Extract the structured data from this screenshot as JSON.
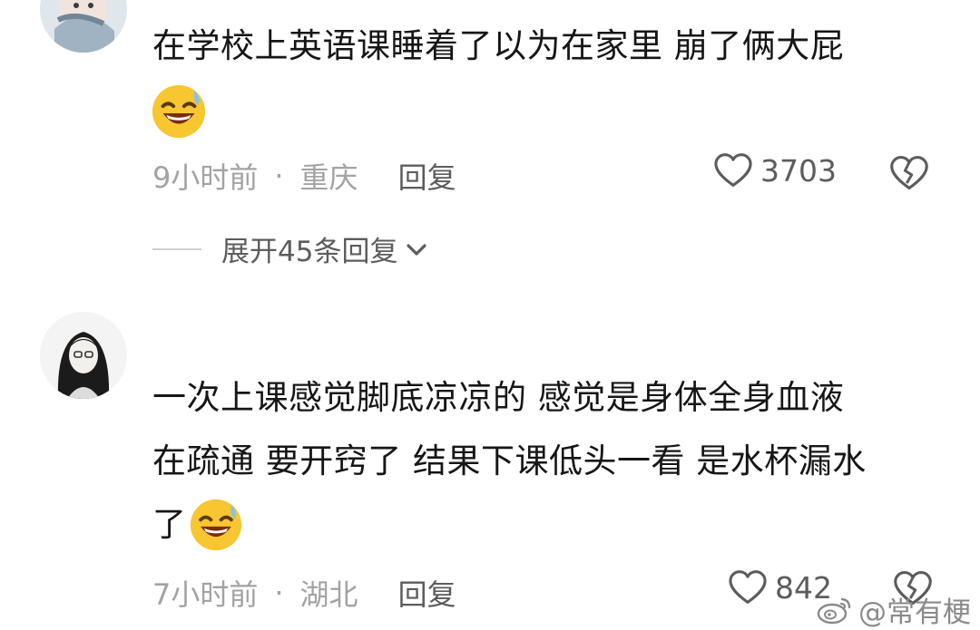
{
  "comments": [
    {
      "text_lines": [
        "在学校上英语课睡着了以为在家里 崩了俩大屁"
      ],
      "emoji": "grinning-sweat-emoji",
      "time": "9小时前",
      "separator": "·",
      "location": "重庆",
      "reply_label": "回复",
      "likes": "3703",
      "expand_label": "展开45条回复"
    },
    {
      "text_lines": [
        "一次上课感觉脚底凉凉的 感觉是身体全身血液",
        "在疏通 要开窍了 结果下课低头一看 是水杯漏水",
        "了"
      ],
      "emoji": "grinning-sweat-emoji",
      "time": "7小时前",
      "separator": "·",
      "location": "湖北",
      "reply_label": "回复",
      "likes": "842"
    }
  ],
  "watermark": "@常有梗",
  "icons": {
    "like": "heart-outline-icon",
    "dislike": "broken-heart-icon",
    "expand": "chevron-down-icon",
    "watermark": "weibo-logo-icon"
  },
  "colors": {
    "text": "#161616",
    "meta": "#a3a3a3",
    "secondary": "#5c5c5c",
    "emoji_face": "#f7c631"
  }
}
